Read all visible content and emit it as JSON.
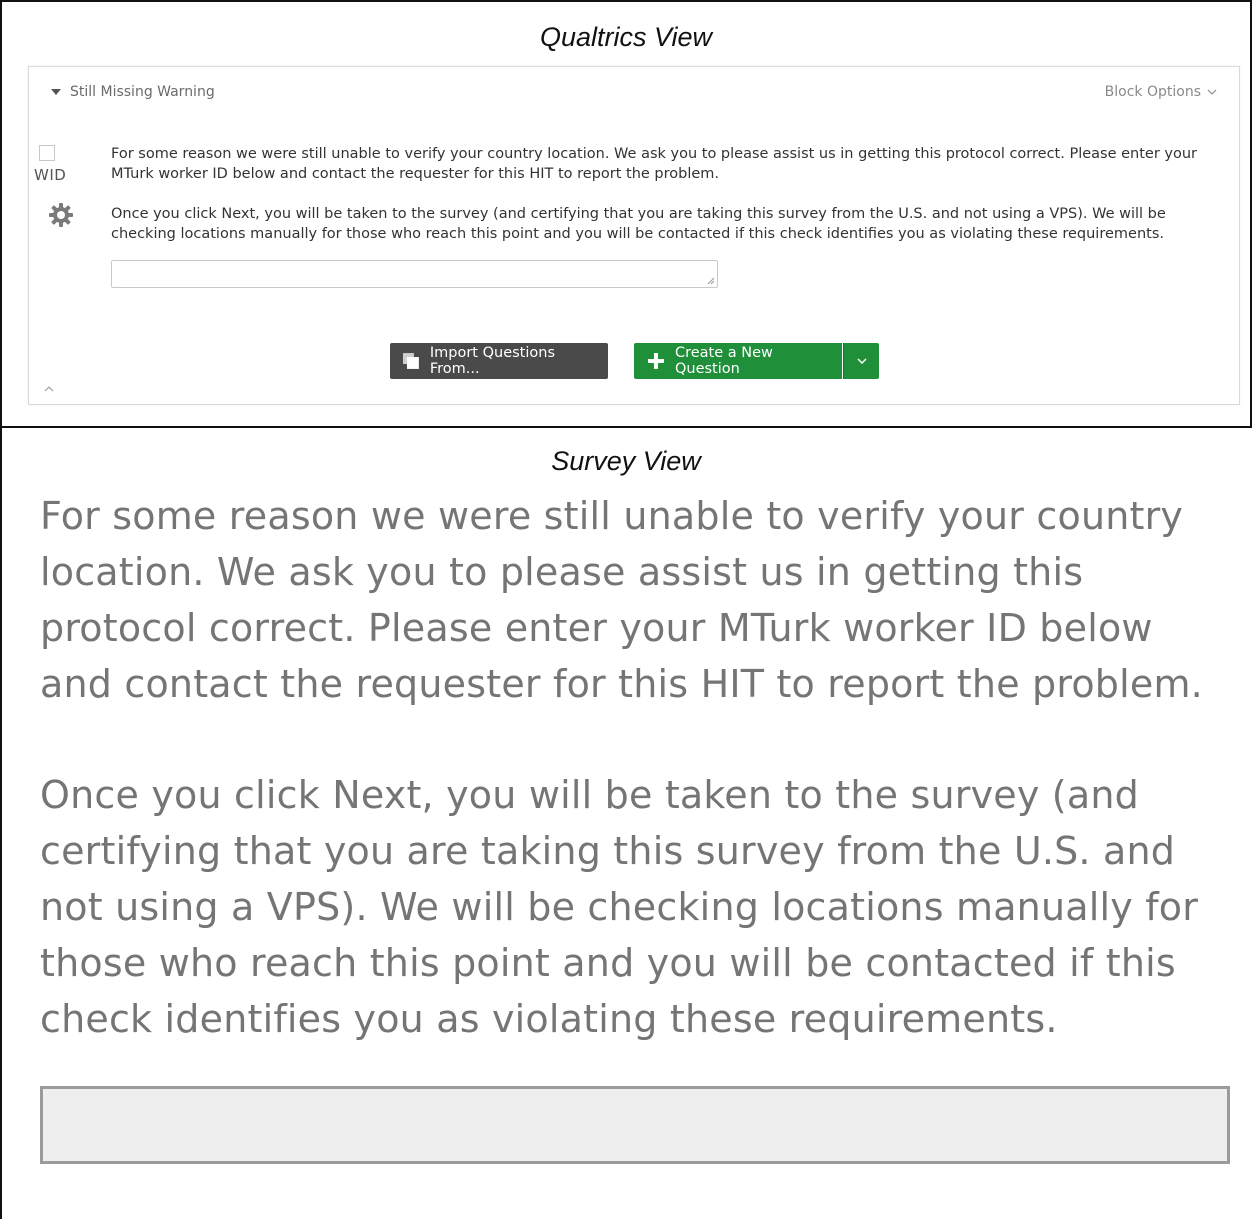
{
  "captions": {
    "top": "Qualtrics View",
    "bottom": "Survey View"
  },
  "editor": {
    "block_name": "Still Missing Warning",
    "block_options_label": "Block Options",
    "question_id": "WID",
    "paragraph1": "For some reason we were still unable to verify your country location. We ask you to please assist us in getting this protocol correct. Please enter your MTurk worker ID below and contact the requester for this HIT to report the problem.",
    "paragraph2": "Once you click Next, you will be taken to the survey (and certifying that you are taking this survey from the U.S. and not using a VPS). We will be checking locations manually for those who reach this point and you will be contacted if this check identifies you as violating these requirements.",
    "input_value": "",
    "import_button_label": "Import Questions From...",
    "create_button_label": "Create a New Question",
    "icons": [
      "caret-down-icon",
      "chevron-down-icon",
      "gear-icon",
      "copy-icon",
      "plus-icon",
      "chevron-up-icon",
      "resize-grip-icon"
    ]
  },
  "survey": {
    "paragraph1": "For some reason we were still unable to verify your country location. We ask you to please assist us in getting this protocol correct. Please enter your MTurk worker ID below and contact the requester for this HIT to report the problem.",
    "paragraph2": "Once you click Next, you will be taken to the survey (and certifying that you are taking this survey from the U.S. and not using a VPS). We will be checking locations manually for those who reach this point and you will be contacted if this check identifies you as violating these requirements.",
    "input_value": ""
  },
  "colors": {
    "create_button": "#1f8f3a",
    "import_button": "#4a4a4a",
    "survey_text": "#757575",
    "survey_input_bg": "#eeeeee"
  }
}
